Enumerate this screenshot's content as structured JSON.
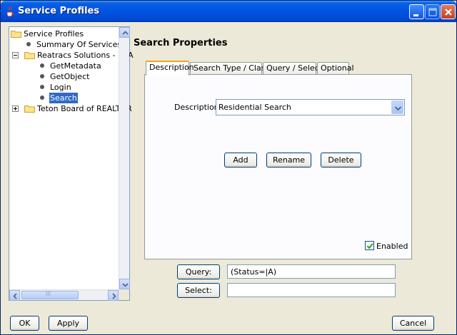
{
  "window": {
    "title": "Service Profiles"
  },
  "tree": {
    "items": [
      {
        "label": "Service Profiles"
      },
      {
        "label": "Summary Of Services"
      },
      {
        "label": "Reatracs Solutions - ERA"
      },
      {
        "label": "GetMetadata"
      },
      {
        "label": "GetObject"
      },
      {
        "label": "Login"
      },
      {
        "label": "Search"
      },
      {
        "label": "Teton Board of REALTOR"
      }
    ],
    "hscroll_grip": "III"
  },
  "panel": {
    "heading": "Search Properties",
    "tabs": [
      "Description",
      "Search Type / Class",
      "Query / Select",
      "Optional"
    ],
    "description_label": "Description:",
    "description_value": "Residential Search",
    "add_label": "Add",
    "rename_label": "Rename",
    "delete_label": "Delete",
    "enabled_label": "Enabled"
  },
  "query": {
    "button_label": "Query:",
    "value": "(Status=|A)"
  },
  "select": {
    "button_label": "Select:",
    "value": ""
  },
  "footer": {
    "ok_label": "OK",
    "apply_label": "Apply",
    "cancel_label": "Cancel"
  },
  "colors": {
    "title_bar": "#0054e3",
    "selection": "#316ac5",
    "tab_accent": "#f9a21b"
  }
}
